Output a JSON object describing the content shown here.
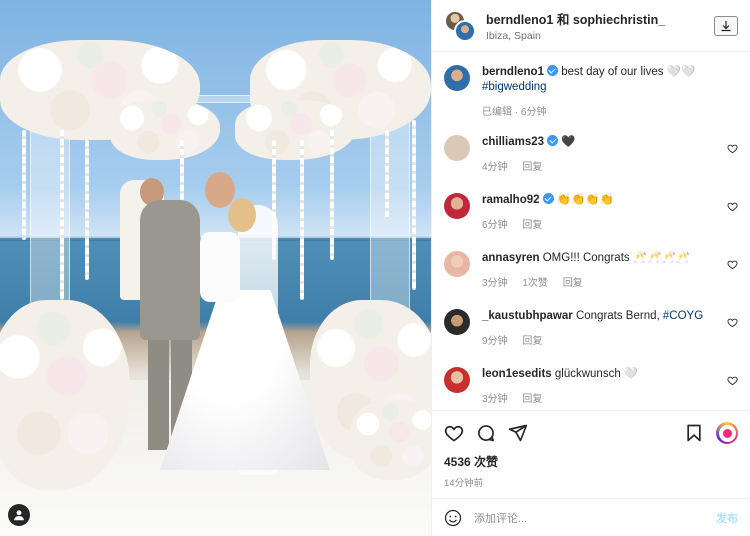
{
  "header": {
    "title": "berndleno1 和 sophiechristin_",
    "location": "Ibiza, Spain"
  },
  "caption": {
    "user": "berndleno1",
    "text": "best day of our lives 🤍🤍",
    "hashtag": "#bigwedding",
    "meta_edited": "已编辑",
    "meta_time": "6分钟",
    "meta_sep": " · "
  },
  "comments": [
    {
      "user": "chilliams23",
      "verified": true,
      "text": "🖤",
      "time": "4分钟",
      "likes": "",
      "reply": "回复",
      "avatar_color": "#d9c9b6"
    },
    {
      "user": "ramalho92",
      "verified": true,
      "text": "👏👏👏👏",
      "time": "6分钟",
      "likes": "",
      "reply": "回复",
      "avatar_color": "#c0283a"
    },
    {
      "user": "annasyren",
      "verified": false,
      "text": "OMG!!! Congrats 🥂🥂🥂🥂",
      "time": "3分钟",
      "likes": "1次赞",
      "reply": "回复",
      "avatar_color": "#e7b7a6"
    },
    {
      "user": "_kaustubhpawar",
      "verified": false,
      "text": "Congrats Bernd, ",
      "tag": "#COYG",
      "time": "9分钟",
      "likes": "",
      "reply": "回复",
      "avatar_color": "#2b2b2b"
    },
    {
      "user": "leon1esedits",
      "verified": false,
      "text": "glückwunsch 🤍",
      "time": "3分钟",
      "likes": "",
      "reply": "回复",
      "avatar_color": "#c6302f"
    }
  ],
  "actions": {
    "likes_count": "4536 次赞",
    "posted_time": "14分钟前"
  },
  "add_comment": {
    "placeholder": "添加评论...",
    "post_label": "发布"
  },
  "icons": {
    "download": "download-icon",
    "heart": "heart-icon",
    "comment": "comment-icon",
    "share": "share-icon",
    "bookmark": "bookmark-icon",
    "emoji": "emoji-icon",
    "user": "user-icon"
  },
  "colors": {
    "verified": "#3897f0",
    "hashtag": "#00376b",
    "muted": "#8e8e8e",
    "post_disabled": "#b2dffc"
  }
}
